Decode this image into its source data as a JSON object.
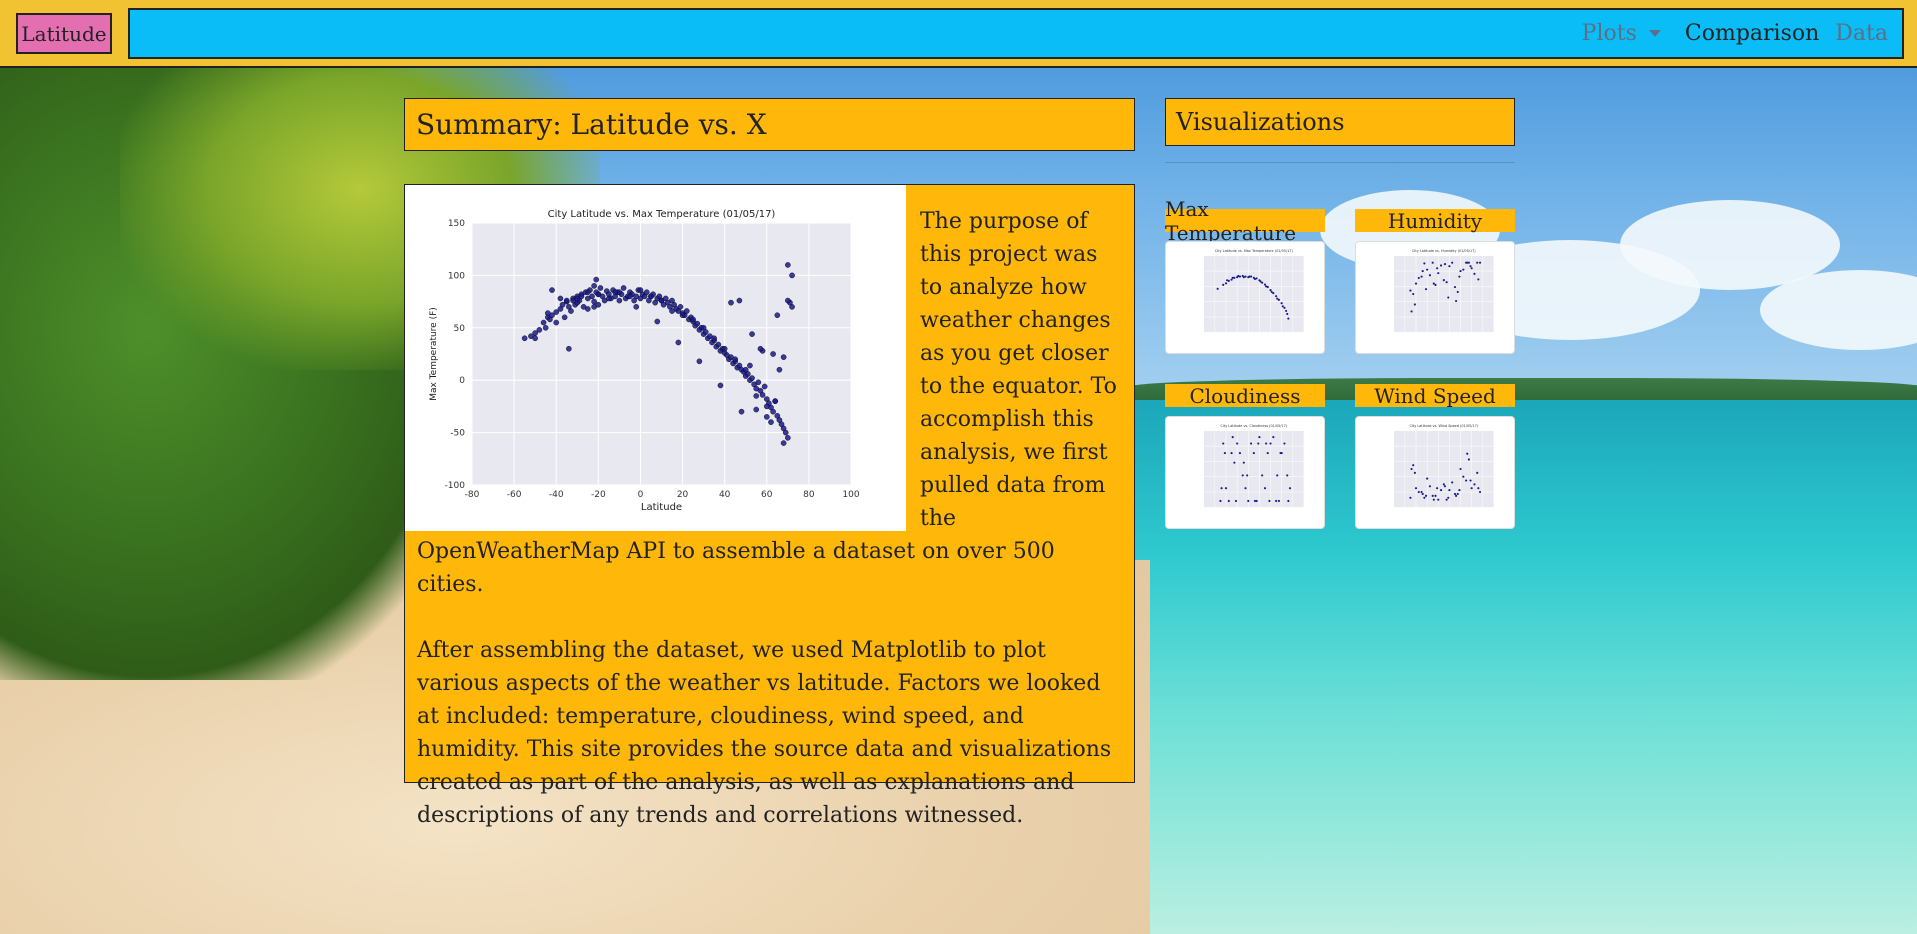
{
  "nav": {
    "brand": "Latitude",
    "links": [
      {
        "label": "Plots",
        "dropdown": true,
        "active": false
      },
      {
        "label": "Comparison",
        "dropdown": false,
        "active": true
      },
      {
        "label": "Data",
        "dropdown": false,
        "active": false
      }
    ]
  },
  "summary": {
    "title": "Summary: Latitude vs. X",
    "paragraphs": [
      "The purpose of this project was to analyze how weather changes as you get closer to the equator. To accomplish this analysis, we first pulled data from the OpenWeatherMap API to assemble a dataset on over 500 cities.",
      "After assembling the dataset, we used Matplotlib to plot various aspects of the weather vs latitude. Factors we looked at included: temperature, cloudiness, wind speed, and humidity. This site provides the source data and visualizations created as part of the analysis, as well as explanations and descriptions of any trends and correlations witnessed."
    ]
  },
  "visualizations": {
    "title": "Visualizations",
    "items": [
      {
        "label": "Max Temperature",
        "icon": "scatter-thumbnail"
      },
      {
        "label": "Humidity",
        "icon": "scatter-thumbnail"
      },
      {
        "label": "Cloudiness",
        "icon": "scatter-thumbnail"
      },
      {
        "label": "Wind Speed",
        "icon": "scatter-thumbnail"
      }
    ]
  },
  "colors": {
    "navbar_bg": "#f1c232",
    "nav_inner": "#0bbdf7",
    "brand_bg": "#e46fb0",
    "panel_bg": "#ffb80a",
    "point": "#1a1a8c"
  },
  "chart_data": {
    "type": "scatter",
    "title": "City Latitude vs. Max Temperature (01/05/17)",
    "xlabel": "Latitude",
    "ylabel": "Max Temperature (F)",
    "xlim": [
      -80,
      100
    ],
    "ylim": [
      -100,
      150
    ],
    "xticks": [
      -80,
      -60,
      -40,
      -20,
      0,
      20,
      40,
      60,
      80,
      100
    ],
    "yticks": [
      -100,
      -50,
      0,
      50,
      100,
      150
    ],
    "grid": true,
    "point_color": "#1a1a8c",
    "x": [
      -55,
      -52,
      -50,
      -48,
      -46,
      -45,
      -44,
      -43,
      -42,
      -40,
      -40,
      -38,
      -37,
      -36,
      -35,
      -34,
      -33,
      -32,
      -31,
      -30,
      -30,
      -29,
      -28,
      -27,
      -26,
      -25,
      -25,
      -24,
      -23,
      -22,
      -22,
      -21,
      -20,
      -20,
      -19,
      -18,
      -17,
      -16,
      -15,
      -14,
      -13,
      -12,
      -11,
      -10,
      -9,
      -8,
      -7,
      -6,
      -5,
      -4,
      -3,
      -2,
      -1,
      0,
      1,
      2,
      3,
      4,
      5,
      6,
      7,
      8,
      9,
      10,
      11,
      12,
      13,
      14,
      15,
      16,
      17,
      18,
      19,
      20,
      21,
      22,
      23,
      24,
      25,
      26,
      27,
      28,
      29,
      30,
      31,
      32,
      33,
      34,
      35,
      36,
      37,
      38,
      39,
      40,
      41,
      42,
      43,
      44,
      45,
      46,
      47,
      48,
      49,
      50,
      51,
      52,
      53,
      54,
      55,
      56,
      57,
      58,
      59,
      60,
      61,
      62,
      63,
      64,
      65,
      66,
      67,
      68,
      69,
      70,
      71,
      72,
      -38,
      -35,
      -28,
      -25,
      -20,
      -15,
      -10,
      -5,
      0,
      5,
      10,
      15,
      20,
      25,
      30,
      35,
      40,
      45,
      50,
      55,
      60,
      65,
      70,
      -42,
      -32,
      -22,
      -12,
      -2,
      8,
      18,
      28,
      38,
      48,
      58,
      68,
      52,
      55,
      60,
      62,
      64,
      66,
      68,
      70,
      72,
      -21,
      -30,
      -34,
      -44,
      -50,
      43,
      47,
      53,
      57,
      63,
      67,
      74
    ],
    "y": [
      40,
      42,
      45,
      48,
      55,
      50,
      60,
      58,
      62,
      55,
      65,
      68,
      72,
      60,
      75,
      70,
      66,
      78,
      72,
      80,
      74,
      76,
      82,
      70,
      84,
      78,
      68,
      86,
      80,
      75,
      90,
      84,
      82,
      72,
      88,
      80,
      76,
      85,
      82,
      78,
      86,
      80,
      84,
      76,
      82,
      88,
      78,
      80,
      84,
      82,
      76,
      80,
      86,
      78,
      82,
      80,
      84,
      76,
      80,
      82,
      74,
      78,
      80,
      76,
      72,
      78,
      74,
      70,
      76,
      72,
      68,
      66,
      70,
      64,
      62,
      66,
      58,
      60,
      56,
      52,
      54,
      48,
      50,
      44,
      46,
      40,
      42,
      36,
      38,
      32,
      34,
      28,
      30,
      26,
      24,
      20,
      22,
      16,
      18,
      12,
      14,
      10,
      8,
      4,
      6,
      0,
      2,
      -4,
      -8,
      -2,
      -10,
      -14,
      -6,
      -18,
      -22,
      -26,
      -30,
      -20,
      -34,
      -38,
      -42,
      -46,
      -50,
      -55,
      74,
      70,
      78,
      76,
      80,
      84,
      82,
      78,
      84,
      80,
      86,
      80,
      76,
      66,
      62,
      58,
      50,
      40,
      30,
      20,
      10,
      -15,
      -25,
      62,
      76,
      86,
      76,
      70,
      84,
      70,
      56,
      36,
      18,
      -5,
      -30,
      28,
      22,
      14,
      -28,
      -35,
      -40,
      -20,
      10,
      -60,
      110,
      100,
      96,
      78,
      30,
      64,
      40,
      74,
      76,
      44,
      30,
      25
    ]
  },
  "thumbnails": [
    {
      "title": "City Latitude vs. Max Temperature (01/05/17)",
      "x": [
        -55,
        -45,
        -40,
        -35,
        -30,
        -25,
        -20,
        -15,
        -10,
        -5,
        0,
        5,
        10,
        15,
        20,
        25,
        30,
        35,
        40,
        45,
        50,
        55,
        60,
        65,
        70,
        -38,
        -28,
        -18,
        -8,
        2,
        12,
        22,
        32,
        42,
        52,
        62,
        68,
        72
      ],
      "y": [
        42,
        55,
        60,
        68,
        72,
        78,
        80,
        82,
        84,
        82,
        80,
        82,
        78,
        76,
        70,
        62,
        56,
        48,
        38,
        28,
        18,
        6,
        -5,
        -20,
        -40,
        70,
        78,
        84,
        80,
        82,
        74,
        66,
        50,
        32,
        10,
        -15,
        -30,
        -55
      ],
      "ylim": [
        -100,
        150
      ]
    },
    {
      "title": "City Latitude vs. Humidity (01/05/17)",
      "x": [
        -50,
        -40,
        -30,
        -20,
        -10,
        0,
        10,
        20,
        30,
        40,
        50,
        60,
        70,
        -45,
        -35,
        -25,
        -15,
        -5,
        5,
        15,
        25,
        35,
        45,
        55,
        65,
        75,
        -42,
        -22,
        -2,
        18,
        38,
        58,
        -48,
        -28,
        -8,
        12,
        32,
        52,
        72
      ],
      "y": [
        60,
        70,
        80,
        90,
        100,
        85,
        75,
        95,
        65,
        88,
        100,
        92,
        100,
        55,
        78,
        99,
        82,
        68,
        96,
        72,
        100,
        58,
        90,
        100,
        84,
        100,
        40,
        62,
        92,
        50,
        80,
        95,
        30,
        88,
        70,
        98,
        45,
        100,
        76
      ],
      "ylim": [
        0,
        110
      ]
    },
    {
      "title": "City Latitude vs. Cloudiness (01/05/17)",
      "x": [
        -50,
        -40,
        -30,
        -20,
        -10,
        0,
        10,
        20,
        30,
        40,
        50,
        60,
        70,
        -45,
        -35,
        -25,
        -15,
        -5,
        5,
        15,
        25,
        35,
        45,
        55,
        65,
        75,
        -42,
        -22,
        -2,
        18,
        38,
        58,
        -48,
        -28,
        -8,
        12,
        32,
        52,
        72
      ],
      "y": [
        0,
        20,
        75,
        90,
        40,
        0,
        75,
        100,
        20,
        90,
        0,
        75,
        40,
        90,
        0,
        60,
        75,
        20,
        90,
        0,
        40,
        75,
        100,
        0,
        90,
        20,
        75,
        0,
        40,
        90,
        0,
        75,
        20,
        100,
        60,
        0,
        90,
        40,
        0
      ],
      "ylim": [
        -10,
        110
      ]
    },
    {
      "title": "City Latitude vs. Wind Speed (01/05/17)",
      "x": [
        -50,
        -40,
        -30,
        -20,
        -10,
        0,
        10,
        20,
        30,
        40,
        50,
        60,
        70,
        -45,
        -35,
        -25,
        -15,
        -5,
        5,
        15,
        25,
        35,
        45,
        55,
        65,
        75,
        -42,
        -22,
        -2,
        18,
        38,
        58,
        -48,
        -28,
        -8,
        12,
        32,
        52,
        72
      ],
      "y": [
        5,
        10,
        8,
        15,
        6,
        4,
        12,
        9,
        7,
        20,
        14,
        10,
        18,
        22,
        8,
        5,
        11,
        6,
        9,
        4,
        13,
        7,
        16,
        25,
        12,
        8,
        18,
        6,
        10,
        5,
        9,
        14,
        20,
        7,
        4,
        11,
        6,
        28,
        10
      ],
      "ylim": [
        0,
        40
      ]
    }
  ]
}
